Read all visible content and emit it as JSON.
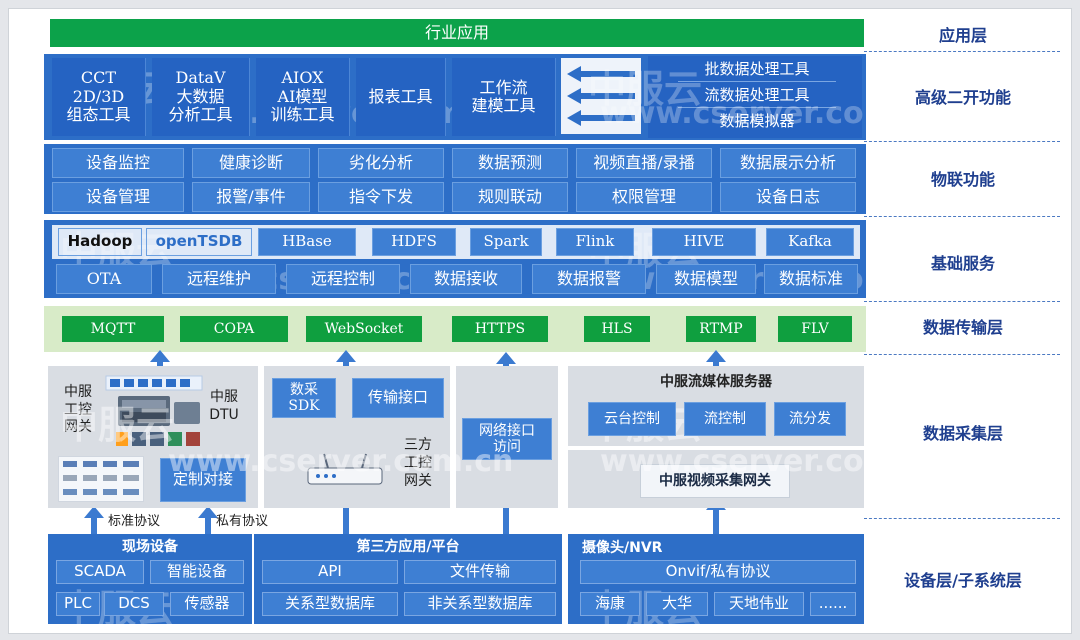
{
  "layers": {
    "app": "应用层",
    "adv": "高级二开功能",
    "iot": "物联功能",
    "base": "基础服务",
    "trans": "数据传输层",
    "collect": "数据采集层",
    "device": "设备层/子系统层"
  },
  "app_bar": "行业应用",
  "advanced": {
    "tools": [
      [
        "CCT",
        "2D/3D",
        "组态工具"
      ],
      [
        "DataV",
        "大数据",
        "分析工具"
      ],
      [
        "AIOX",
        "AI模型",
        "训练工具"
      ],
      [
        "报表工具"
      ],
      [
        "工作流",
        "建模工具"
      ]
    ],
    "processing": [
      "批数据处理工具",
      "流数据处理工具",
      "数据模拟器"
    ]
  },
  "iot": {
    "row1": [
      "设备监控",
      "健康诊断",
      "劣化分析",
      "数据预测",
      "视频直播/录播",
      "数据展示分析"
    ],
    "row2": [
      "设备管理",
      "报警/事件",
      "指令下发",
      "规则联动",
      "权限管理",
      "设备日志"
    ]
  },
  "base": {
    "row1": [
      "Hadoop",
      "openTSDB",
      "HBase",
      "HDFS",
      "Spark",
      "Flink",
      "HIVE",
      "Kafka"
    ],
    "row2": [
      "OTA",
      "远程维护",
      "远程控制",
      "数据接收",
      "数据报警",
      "数据模型",
      "数据标准"
    ]
  },
  "transport": [
    "MQTT",
    "COPA",
    "WebSocket",
    "HTTPS",
    "HLS",
    "RTMP",
    "FLV"
  ],
  "collect": {
    "gateway_label": [
      "中服",
      "工控",
      "网关"
    ],
    "dtu_label": [
      "中服",
      "DTU"
    ],
    "custom_dock": "定制对接",
    "sdk": [
      "数采",
      "SDK"
    ],
    "transfer_iface": "传输接口",
    "third_gateway": [
      "三方",
      "工控",
      "网关"
    ],
    "net_iface": [
      "网络接口",
      "访问"
    ],
    "media_server": "中服流媒体服务器",
    "media_items": [
      "云台控制",
      "流控制",
      "流分发"
    ],
    "video_gateway": "中服视频采集网关"
  },
  "protocols": {
    "standard": "标准协议",
    "private": "私有协议"
  },
  "devices": {
    "field": {
      "title": "现场设备",
      "items": [
        "SCADA",
        "智能设备",
        "PLC",
        "DCS",
        "传感器"
      ]
    },
    "third": {
      "title": "第三方应用/平台",
      "items": [
        "API",
        "文件传输",
        "关系型数据库",
        "非关系型数据库"
      ]
    },
    "camera": {
      "title": "摄像头/NVR",
      "items": [
        "Onvif/私有协议",
        "海康",
        "大华",
        "天地伟业",
        "......"
      ]
    }
  },
  "watermarks": [
    "中服云",
    "www.cserver.com.cn"
  ],
  "colors": {
    "primary": "#2d6ec7",
    "green": "#0f9f3f",
    "label": "#1f3f8f",
    "transport_bg": "#d8ebc8"
  }
}
